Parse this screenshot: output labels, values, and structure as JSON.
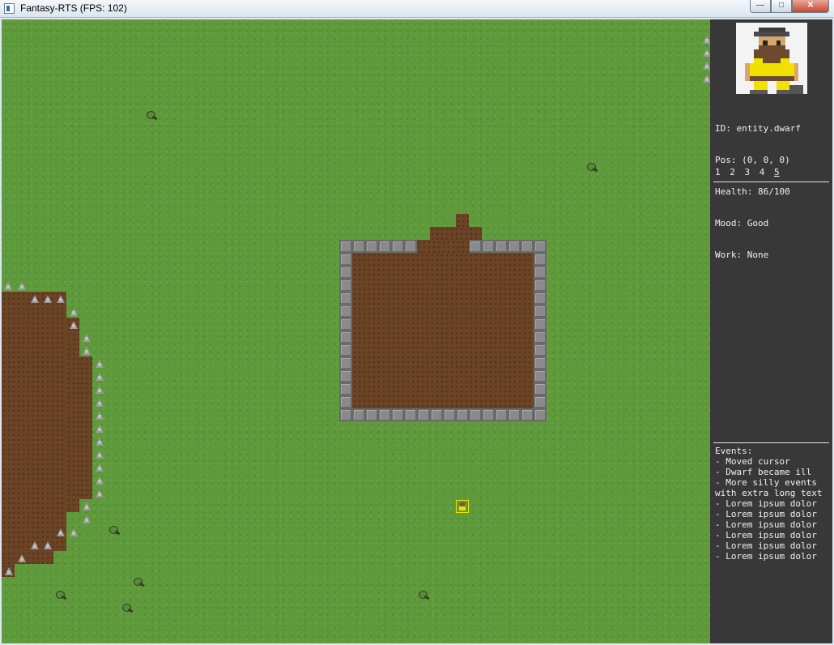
{
  "window": {
    "title": "Fantasy-RTS (FPS: 102)",
    "buttons": {
      "minimize": "—",
      "maximize": "□",
      "close": "✕"
    }
  },
  "entity": {
    "id": "ID: entity.dwarf",
    "pos": "Pos: (0, 0, 0)",
    "health": "Health: 86/100",
    "mood": "Mood: Good",
    "work": "Work: None"
  },
  "tabs": {
    "items": [
      "1",
      "2",
      "3",
      "4",
      "5"
    ],
    "active": "5"
  },
  "events": {
    "header": "Events:",
    "items": [
      "- Moved cursor",
      "- Dwarf became ill",
      "- More silly events with extra long text",
      "- Lorem ipsum dolor",
      "- Lorem ipsum dolor",
      "- Lorem ipsum dolor",
      "- Lorem ipsum dolor",
      "- Lorem ipsum dolor",
      "- Lorem ipsum dolor"
    ]
  },
  "colors": {
    "grass": "#5e9a3c",
    "dirt": "#6b4325",
    "stone_wall": "#8a8a8a",
    "panel": "#383838",
    "selection": "#f0e000"
  }
}
